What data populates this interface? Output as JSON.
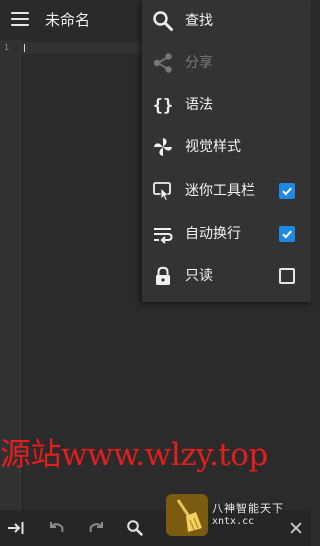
{
  "appbar": {
    "title": "未命名"
  },
  "editor": {
    "line_numbers": [
      "1"
    ]
  },
  "menu": {
    "items": [
      {
        "label": "查找",
        "icon": "search-icon",
        "enabled": true
      },
      {
        "label": "分享",
        "icon": "share-icon",
        "enabled": false
      },
      {
        "label": "语法",
        "icon": "braces-icon",
        "enabled": true
      },
      {
        "label": "视觉样式",
        "icon": "pinwheel-icon",
        "enabled": true
      },
      {
        "label": "迷你工具栏",
        "icon": "mini-toolbar-icon",
        "enabled": true,
        "checked": true
      },
      {
        "label": "自动换行",
        "icon": "word-wrap-icon",
        "enabled": true,
        "checked": true
      },
      {
        "label": "只读",
        "icon": "lock-icon",
        "enabled": true,
        "checked": false
      }
    ]
  },
  "watermark": {
    "text": "源站www.wlzy.top"
  },
  "toolbar": {
    "buttons": [
      "tab-icon",
      "undo-icon",
      "redo-icon",
      "search-icon",
      "close-icon"
    ]
  },
  "corner_logo": {
    "line1": "八神智能天下",
    "line2": "xntx.cc"
  },
  "colors": {
    "accent": "#1e88e5",
    "watermark": "#e21e1e",
    "background": "#2b2b2b",
    "menu_background": "#333333"
  }
}
